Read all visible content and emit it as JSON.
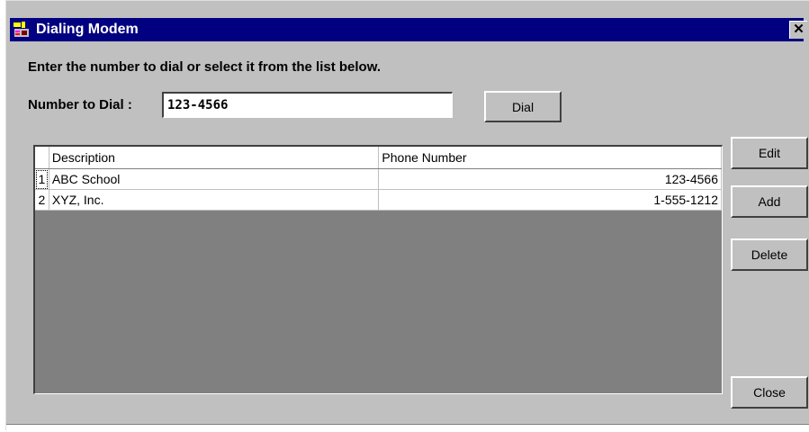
{
  "window": {
    "title": "Dialing Modem",
    "close_glyph": "✕",
    "icon": "modem-app-icon"
  },
  "instructions": "Enter the number to dial or select it from the list below.",
  "dial_form": {
    "label": "Number to Dial :",
    "value": "123-4566",
    "dial_label": "Dial"
  },
  "table": {
    "columns": [
      "Description",
      "Phone Number"
    ],
    "rows": [
      {
        "index": "1",
        "description": "ABC School",
        "phone": "123-4566"
      },
      {
        "index": "2",
        "description": "XYZ, Inc.",
        "phone": "1-555-1212"
      }
    ]
  },
  "buttons": {
    "edit": "Edit",
    "add": "Add",
    "delete": "Delete",
    "close": "Close"
  },
  "colors": {
    "titlebar": "#000080",
    "dialog": "#c0c0c0",
    "grid_empty": "#808080"
  }
}
